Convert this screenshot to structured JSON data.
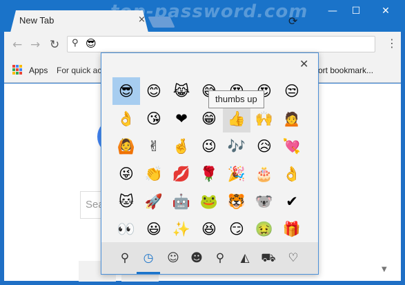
{
  "window": {
    "watermark": "top-password.com",
    "controls": {
      "minimize": "—",
      "maximize": "☐",
      "close": "✕"
    }
  },
  "tab": {
    "title": "New Tab",
    "close": "×"
  },
  "toolbar": {
    "back": "←",
    "forward": "→",
    "reload": "↻",
    "address_value": "😎",
    "menu": "⋮"
  },
  "bookmarks": {
    "apps_label": "Apps",
    "quick_text": "For quick ac",
    "trailing_text": "ort bookmark..."
  },
  "page": {
    "search_placeholder": "Sea"
  },
  "emoji_panel": {
    "close": "✕",
    "tooltip": "thumbs up",
    "rows": [
      [
        "😎",
        "😊",
        "😹",
        "😅",
        "😍",
        "😍",
        "😒"
      ],
      [
        "👌",
        "😘",
        "❤",
        "😁",
        "👍",
        "🙌",
        "🙍"
      ],
      [
        "🙆",
        "✌",
        "🤞",
        "😉",
        "🎶",
        "😥",
        "💘"
      ],
      [
        "😜",
        "👏",
        "💋",
        "🌹",
        "🎉",
        "🎂",
        "👌"
      ],
      [
        "🐱",
        "🚀",
        "🤖",
        "🐸",
        "🐯",
        "🐨",
        "✔"
      ],
      [
        "👀",
        "😃",
        "✨",
        "😆",
        "😏",
        "🤢",
        "🎁"
      ]
    ],
    "selected": "😎",
    "hovered": "👍",
    "categories": [
      {
        "name": "search",
        "glyph": "⚲"
      },
      {
        "name": "recent",
        "glyph": "◷"
      },
      {
        "name": "smileys",
        "glyph": "☺"
      },
      {
        "name": "people",
        "glyph": "☻"
      },
      {
        "name": "places",
        "glyph": "⚲"
      },
      {
        "name": "food",
        "glyph": "◭"
      },
      {
        "name": "transport",
        "glyph": "⛟"
      },
      {
        "name": "symbols",
        "glyph": "♡"
      }
    ]
  },
  "colors": {
    "accent": "#1a73c9",
    "titlebar": "#1a73c9",
    "selected_emoji_bg": "#a7cdf0"
  }
}
